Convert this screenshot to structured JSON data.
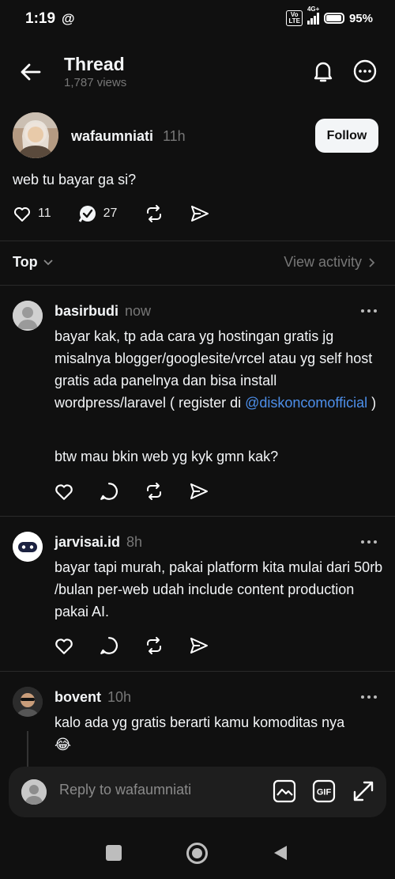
{
  "status_bar": {
    "time": "1:19",
    "threads_glyph": "@",
    "network": "4G+",
    "volte": "Vo LTE",
    "battery": "95%",
    "battery_level": 0.95
  },
  "header": {
    "title": "Thread",
    "views": "1,787 views"
  },
  "post": {
    "author": "wafaumniati",
    "time": "11h",
    "follow_label": "Follow",
    "text": "web tu bayar ga si?",
    "likes": "11",
    "replies": "27"
  },
  "sort": {
    "label": "Top",
    "view_activity": "View activity"
  },
  "replies": [
    {
      "author": "basirbudi",
      "time": "now",
      "body_before": "bayar kak, tp ada cara  yg hostingan gratis jg misalnya blogger/googlesite/vrcel atau yg self host gratis ada panelnya dan bisa install wordpress/laravel ( register di ",
      "mention": "@diskoncomofficial",
      "body_after": " )",
      "body2": "btw mau bkin web yg kyk gmn kak?"
    },
    {
      "author": "jarvisai.id",
      "time": "8h",
      "body": "bayar tapi murah, pakai platform kita mulai dari 50rb /bulan per-web udah include content production pakai AI."
    },
    {
      "author": "bovent",
      "time": "10h",
      "body": "kalo ada yg gratis berarti kamu komoditas nya",
      "emoji": "😂"
    }
  ],
  "reply_bar": {
    "placeholder": "Reply to wafaumniati",
    "gif_label": "GIF"
  },
  "icons": [
    "back-arrow-icon",
    "bell-icon",
    "more-icon",
    "heart-icon",
    "verified-comment-icon",
    "repost-icon",
    "share-icon",
    "comment-icon",
    "chevron-down-icon",
    "chevron-right-icon",
    "image-icon",
    "gif-icon",
    "expand-icon"
  ]
}
